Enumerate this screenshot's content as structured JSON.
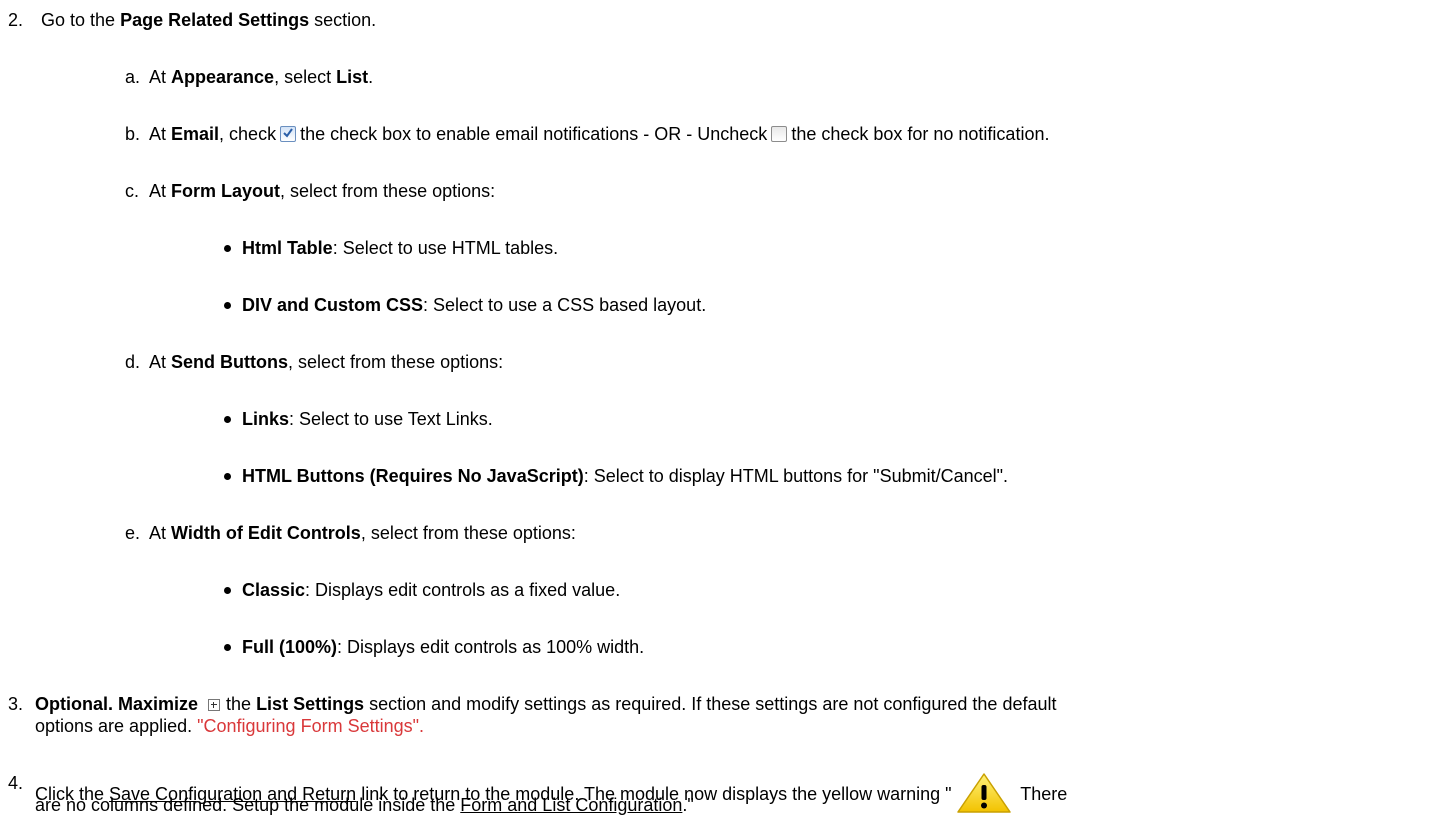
{
  "step2": {
    "num": "2.",
    "pre": "Go to the ",
    "bold": "Page Related Settings",
    "post": " section."
  },
  "a": {
    "letter": "a.",
    "pre": "At ",
    "b1": "Appearance",
    "mid": ", select ",
    "b2": "List",
    "post": "."
  },
  "b": {
    "letter": "b.",
    "pre": "At ",
    "b1": "Email",
    "mid1": ", check",
    "mid2": "the check box to enable email notifications - OR - Uncheck",
    "post": "the check box for no notification."
  },
  "c": {
    "letter": "c.",
    "pre": "At ",
    "b1": "Form Layout",
    "post": ", select from these options:",
    "opt1_bold": "Html Table",
    "opt1_text": ": Select to use HTML tables.",
    "opt2_bold": "DIV and Custom CSS",
    "opt2_text": ": Select to use a CSS based layout."
  },
  "d": {
    "letter": "d.",
    "pre": "At ",
    "b1": "Send Buttons",
    "post": ", select from these options:",
    "opt1_bold": "Links",
    "opt1_text": ": Select to use Text Links.",
    "opt2_bold": "HTML Buttons (Requires No JavaScript)",
    "opt2_text": ": Select to display HTML buttons for \"Submit/Cancel\"."
  },
  "e": {
    "letter": "e.",
    "pre": "At ",
    "b1": "Width of Edit Controls",
    "post": ", select from these options:",
    "opt1_bold": "Classic",
    "opt1_text": ": Displays edit controls as a fixed value.",
    "opt2_bold": "Full (100%)",
    "opt2_text": ": Displays edit controls as 100% width."
  },
  "step3": {
    "num": "3.",
    "b1": "Optional. Maximize",
    "mid1": "the ",
    "b2": "List Settings",
    "mid2": " section and modify settings as required. If these settings are not configured the default",
    "line2_pre": "options are applied. ",
    "link": "\"Configuring Form Settings\"."
  },
  "step4": {
    "num": "4.",
    "pre": "Click the ",
    "link1": "Save Configuration and Return",
    "mid": " link to return to the module. The module now displays the yellow warning \"",
    "post": " There",
    "line2_pre": "are no columns defined. Setup the module inside the ",
    "link2": "Form and List Configuration",
    "line2_post": ".\""
  },
  "colors": {
    "link": "#d9383a",
    "warning": "#f5d000"
  },
  "icons": [
    "checked-checkbox-icon",
    "unchecked-checkbox-icon",
    "maximize-icon",
    "warning-icon"
  ]
}
